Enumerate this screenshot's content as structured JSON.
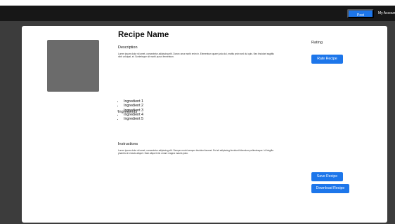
{
  "nav": {
    "post_recipe": "Post Recipe",
    "my_account": "My Account"
  },
  "recipe": {
    "name": "Recipe Name",
    "description_heading": "Description",
    "description_text": "Lorem ipsum dolor sit amet, consectetur adipiscing elit. Donec urna morbi enim in. Elementum quare justo dui, mattis proin sed dui quis. Nec tincidunt sagittis nibh volutpat, et. Scelerisque sit morbi purus fermentum.",
    "ingredients_heading": "Ingredients",
    "ingredients": [
      "Ingredient 1",
      "Ingredient 2",
      "Ingredient 3",
      "Ingredient 4",
      "Ingredient 5"
    ],
    "instructions_heading": "Instructions",
    "instructions_text": "Lorem ipsum dolor sit amet, consectetur adipiscing elit. Semper morbi semper tincidunt laoreet. Est sit adipiscing tincidunt bibendum pellentesque. Id fringilla pharetra in eiusdo aliquet. Nam aliquet nisi ornare magna mauris justo."
  },
  "sidebar": {
    "rating_label": "Rating",
    "rate_button": "Rate Recipe",
    "save_button": "Save Recipe",
    "download_button": "Download Recipe"
  },
  "colors": {
    "accent": "#1d76ea",
    "navbar": "#171717",
    "backdrop": "#3c3c3c"
  }
}
